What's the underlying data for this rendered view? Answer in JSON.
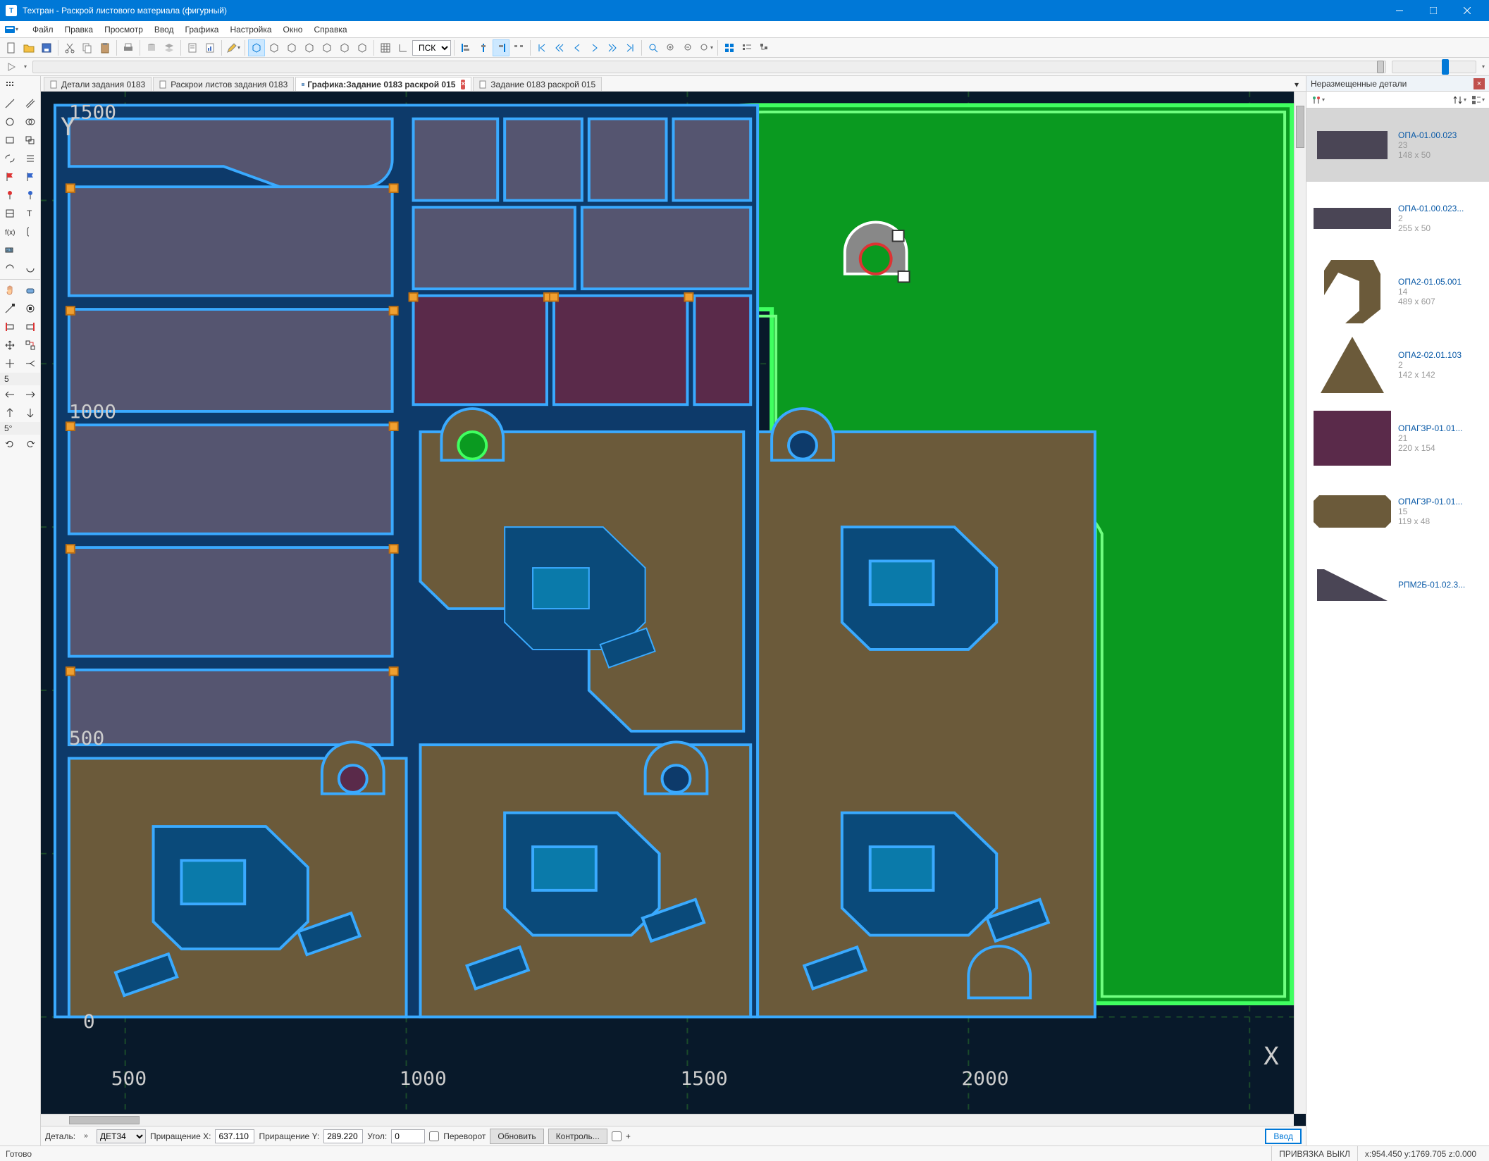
{
  "app": {
    "title": "Техтран - Раскрой листового материала (фигурный)"
  },
  "menu": {
    "items": [
      "Файл",
      "Правка",
      "Просмотр",
      "Ввод",
      "Графика",
      "Настройка",
      "Окно",
      "Справка"
    ]
  },
  "toolbar": {
    "pck_select": {
      "value": "ПСК",
      "options": [
        "ПСК"
      ]
    }
  },
  "left_palette": {
    "step_label": "5",
    "angle_label": "5°"
  },
  "tabs": [
    {
      "label": "Детали задания 0183",
      "active": false,
      "closeable": false
    },
    {
      "label": "Раскрои листов задания 0183",
      "active": false,
      "closeable": false
    },
    {
      "label": "Графика:Задание 0183 раскрой 015",
      "active": true,
      "closeable": true
    },
    {
      "label": "Задание 0183 раскрой 015",
      "active": false,
      "closeable": false
    }
  ],
  "canvas": {
    "axis_x_label": "X",
    "axis_y_label": "Y",
    "x_ticks": [
      "500",
      "1000",
      "1500",
      "2000"
    ],
    "y_ticks": [
      "0",
      "500",
      "1000",
      "1500"
    ]
  },
  "bottom": {
    "detail_label": "Деталь:",
    "detail_value": "ДЕТ34",
    "inc_x_label": "Приращение X:",
    "inc_x_value": "637.110",
    "inc_y_label": "Приращение Y:",
    "inc_y_value": "289.220",
    "angle_label": "Угол:",
    "angle_value": "0",
    "flip_label": "Переворот",
    "update_btn": "Обновить",
    "control_btn": "Контроль...",
    "auto_checkbox_label": "+",
    "submit_btn": "Ввод"
  },
  "right_panel": {
    "title": "Неразмещенные детали",
    "parts": [
      {
        "name": "ОПА-01.00.023",
        "qty": "23",
        "dims": "148 x 50",
        "selected": true,
        "shape": "notch1",
        "fill": "#4a4555"
      },
      {
        "name": "ОПА-01.00.023...",
        "qty": "2",
        "dims": "255 x 50",
        "selected": false,
        "shape": "notch2",
        "fill": "#4a4555"
      },
      {
        "name": "ОПА2-01.05.001",
        "qty": "14",
        "dims": "489 x 607",
        "selected": false,
        "shape": "bracket",
        "fill": "#6b5a3a"
      },
      {
        "name": "ОПА2-02.01.103",
        "qty": "2",
        "dims": "142 x 142",
        "selected": false,
        "shape": "triangle",
        "fill": "#6b5a3a"
      },
      {
        "name": "ОПАГЗР-01.01...",
        "qty": "21",
        "dims": "220 x 154",
        "selected": false,
        "shape": "rect",
        "fill": "#5a2a4a"
      },
      {
        "name": "ОПАГЗР-01.01...",
        "qty": "15",
        "dims": "119 x 48",
        "selected": false,
        "shape": "chamfrect",
        "fill": "#6b5a3a"
      },
      {
        "name": "РПМ2Б-01.02.3...",
        "qty": "",
        "dims": "",
        "selected": false,
        "shape": "triangle2",
        "fill": "#4a4555"
      }
    ]
  },
  "status": {
    "ready": "Готово",
    "snap": "ПРИВЯЗКА ВЫКЛ",
    "coords": "x:954.450 y:1769.705 z:0.000"
  }
}
